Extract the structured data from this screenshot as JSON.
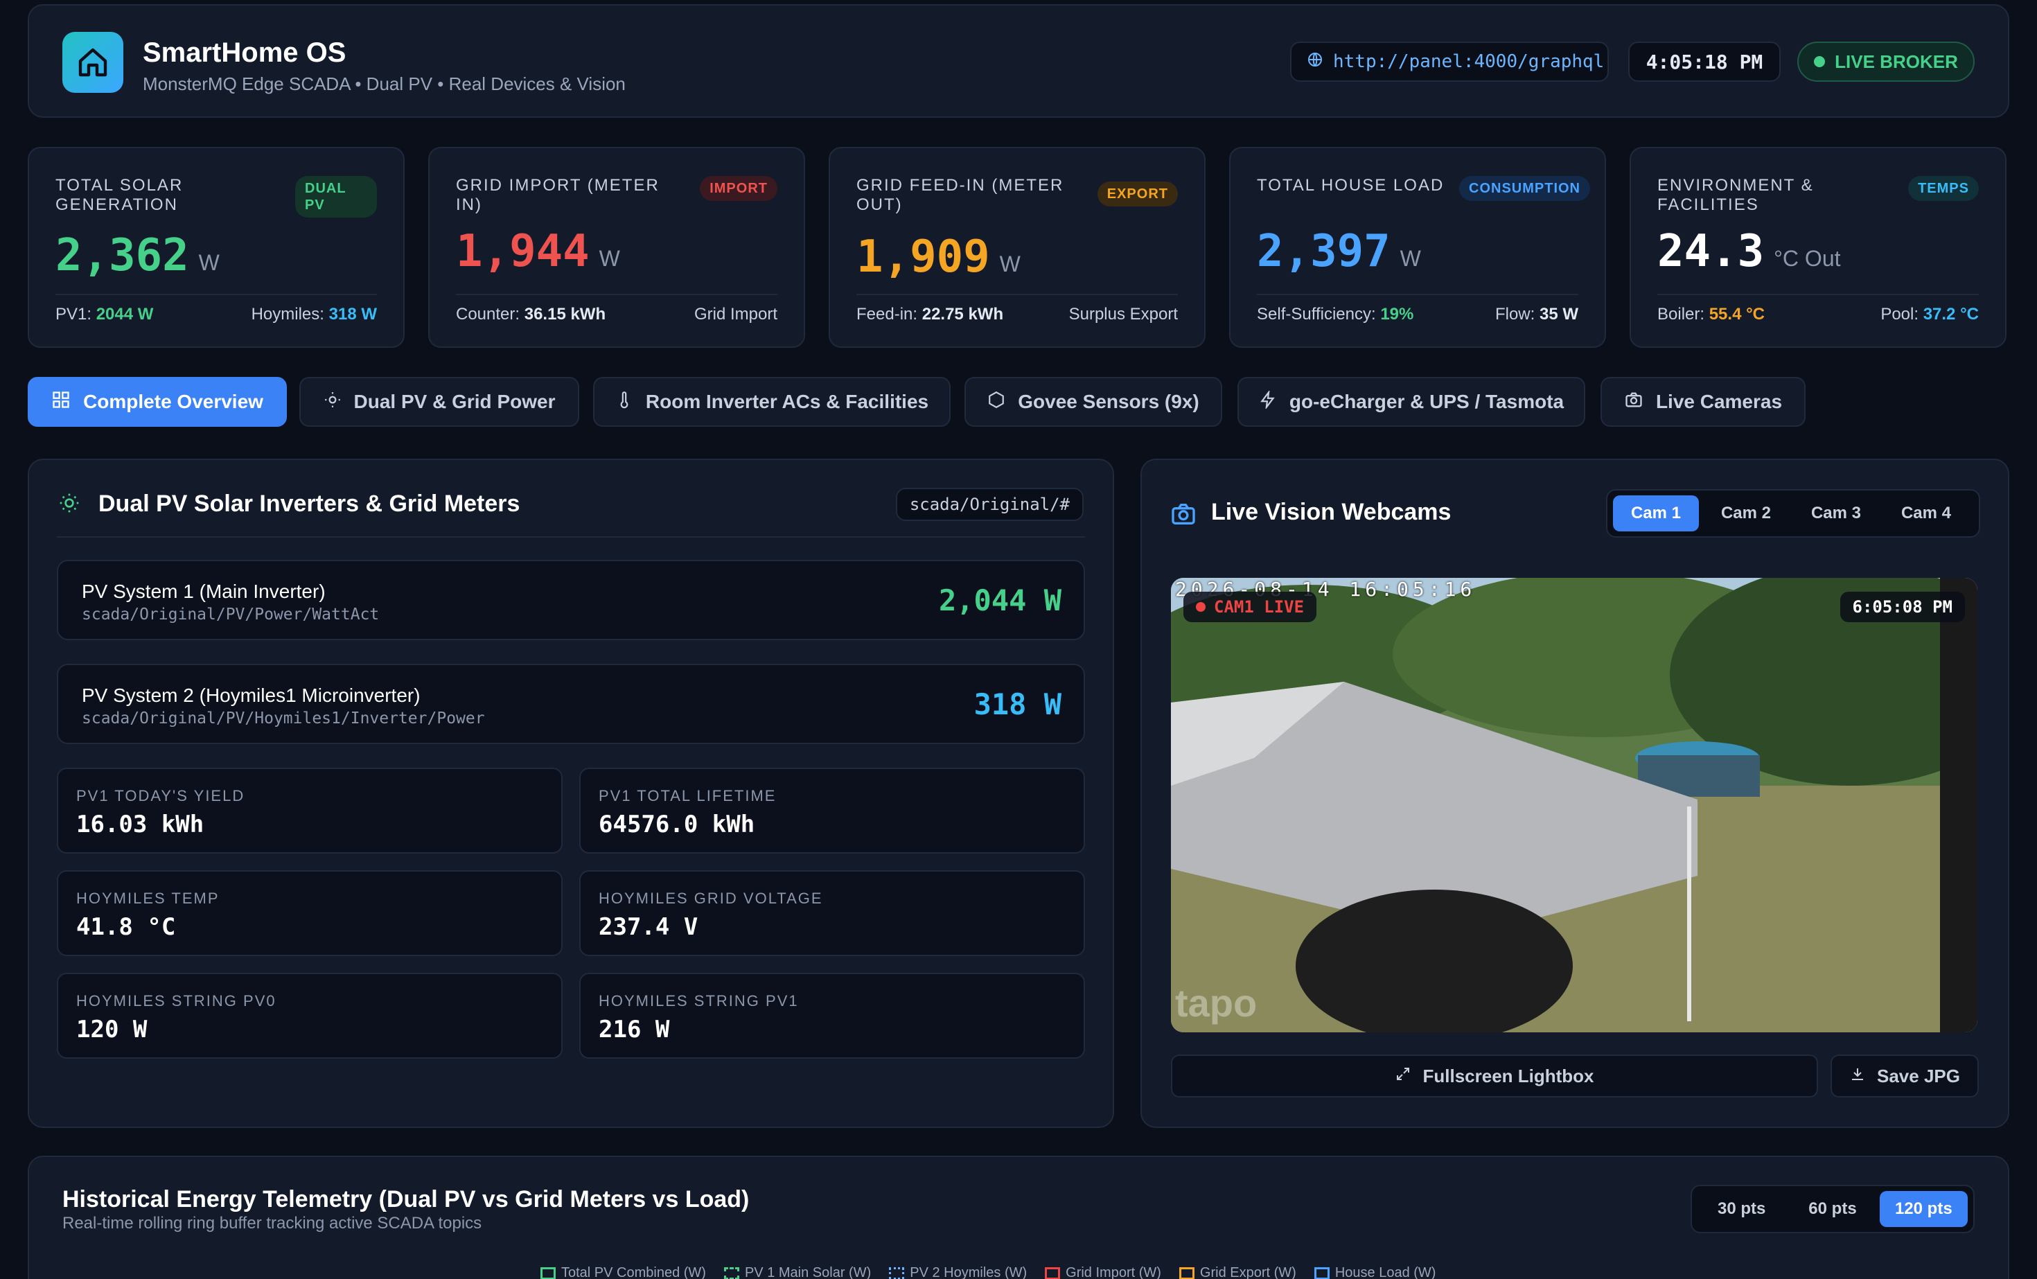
{
  "header": {
    "title": "SmartHome OS",
    "subtitle": "MonsterMQ Edge SCADA • Dual PV • Real Devices & Vision",
    "endpoint": "http://panel:4000/graphql",
    "clock": "4:05:18 PM",
    "broker_status": "LIVE BROKER"
  },
  "kpis": [
    {
      "label": "TOTAL SOLAR GENERATION",
      "badge": "DUAL PV",
      "value": "2,362",
      "unit": "W",
      "foot_left_label": "PV1:",
      "foot_left_value": "2044 W",
      "foot_right_label": "Hoymiles:",
      "foot_right_value": "318 W"
    },
    {
      "label": "GRID IMPORT (METER IN)",
      "badge": "IMPORT",
      "value": "1,944",
      "unit": "W",
      "foot_left_label": "Counter:",
      "foot_left_value": "36.15 kWh",
      "foot_right_label": "Grid Import",
      "foot_right_value": ""
    },
    {
      "label": "GRID FEED-IN (METER OUT)",
      "badge": "EXPORT",
      "value": "1,909",
      "unit": "W",
      "foot_left_label": "Feed-in:",
      "foot_left_value": "22.75 kWh",
      "foot_right_label": "Surplus Export",
      "foot_right_value": ""
    },
    {
      "label": "TOTAL HOUSE LOAD",
      "badge": "CONSUMPTION",
      "value": "2,397",
      "unit": "W",
      "foot_left_label": "Self-Sufficiency:",
      "foot_left_value": "19%",
      "foot_right_label": "Flow:",
      "foot_right_value": "35 W"
    },
    {
      "label": "ENVIRONMENT & FACILITIES",
      "badge": "TEMPS",
      "value": "24.3",
      "unit": "°C Out",
      "foot_left_label": "Boiler:",
      "foot_left_value": "55.4 °C",
      "foot_right_label": "Pool:",
      "foot_right_value": "37.2 °C"
    }
  ],
  "tabs": [
    {
      "label": "Complete Overview",
      "icon": "grid-icon",
      "active": true
    },
    {
      "label": "Dual PV & Grid Power",
      "icon": "sun-icon"
    },
    {
      "label": "Room Inverter ACs & Facilities",
      "icon": "thermometer-icon"
    },
    {
      "label": "Govee Sensors (9x)",
      "icon": "hexagon-icon"
    },
    {
      "label": "go-eCharger & UPS / Tasmota",
      "icon": "bolt-icon"
    },
    {
      "label": "Live Cameras",
      "icon": "camera-icon"
    }
  ],
  "pv_panel": {
    "title": "Dual PV Solar Inverters & Grid Meters",
    "topic": "scada/Original/#",
    "systems": [
      {
        "name": "PV System 1 (Main Inverter)",
        "topic": "scada/Original/PV/Power/WattAct",
        "value": "2,044 W"
      },
      {
        "name": "PV System 2 (Hoymiles1 Microinverter)",
        "topic": "scada/Original/PV/Hoymiles1/Inverter/Power",
        "value": "318 W"
      }
    ],
    "metrics": [
      {
        "label": "PV1 TODAY'S YIELD",
        "value": "16.03 kWh"
      },
      {
        "label": "PV1 TOTAL LIFETIME",
        "value": "64576.0 kWh"
      },
      {
        "label": "HOYMILES TEMP",
        "value": "41.8 °C"
      },
      {
        "label": "HOYMILES GRID VOLTAGE",
        "value": "237.4 V"
      },
      {
        "label": "HOYMILES STRING PV0",
        "value": "120 W"
      },
      {
        "label": "HOYMILES STRING PV1",
        "value": "216 W"
      }
    ]
  },
  "vision_panel": {
    "title": "Live Vision Webcams",
    "cams": [
      "Cam 1",
      "Cam 2",
      "Cam 3",
      "Cam 4"
    ],
    "active_cam": "Cam 1",
    "live_badge": "CAM1 LIVE",
    "feed_time": "6:05:08 PM",
    "osd_stamp": "2026-08-14 16:05:16",
    "watermark": "tapo",
    "fullscreen_label": "Fullscreen Lightbox",
    "save_label": "Save JPG"
  },
  "history_panel": {
    "title": "Historical Energy Telemetry (Dual PV vs Grid Meters vs Load)",
    "subtitle": "Real-time rolling ring buffer tracking active SCADA topics",
    "points": [
      "30 pts",
      "60 pts",
      "120 pts"
    ],
    "active_points": "120 pts",
    "legend": [
      {
        "name": "Total PV Combined (W)",
        "color": "#46d18a"
      },
      {
        "name": "PV 1 Main Solar (W)",
        "color": "#46d18a"
      },
      {
        "name": "PV 2 Hoymiles (W)",
        "color": "#6cb6ff"
      },
      {
        "name": "Grid Import (W)",
        "color": "#ef4444"
      },
      {
        "name": "Grid Export (W)",
        "color": "#f5a524"
      },
      {
        "name": "House Load (W)",
        "color": "#4aa3ff"
      }
    ]
  },
  "colors": {
    "green": "#46d18a",
    "red": "#ef5350",
    "amber": "#f5a524",
    "blue": "#4aa3ff",
    "cyan": "#38bdf8",
    "accent": "#3b82f6"
  }
}
